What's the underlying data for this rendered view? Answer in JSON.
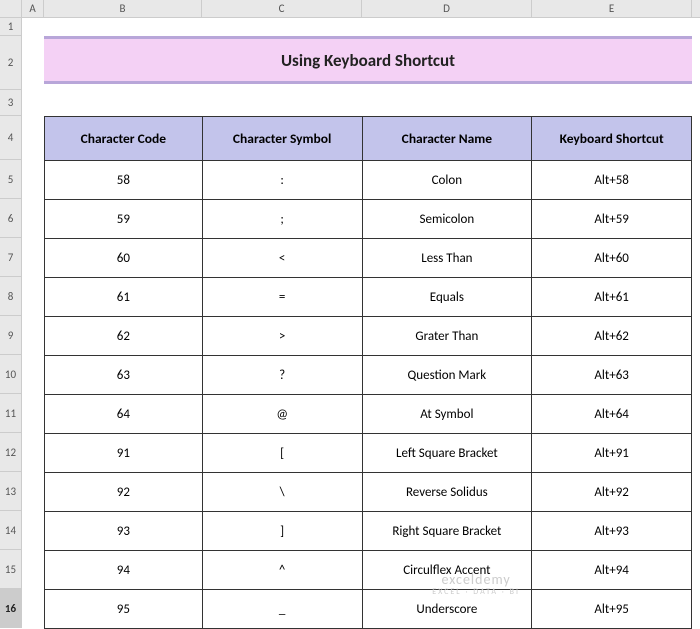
{
  "columns": [
    "A",
    "B",
    "C",
    "D",
    "E"
  ],
  "rows": [
    "1",
    "2",
    "3",
    "4",
    "5",
    "6",
    "7",
    "8",
    "9",
    "10",
    "11",
    "12",
    "13",
    "14",
    "15",
    "16"
  ],
  "selectedRow": "16",
  "title": "Using Keyboard Shortcut",
  "headers": {
    "code": "Character Code",
    "symbol": "Character Symbol",
    "name": "Character Name",
    "shortcut": "Keyboard Shortcut"
  },
  "data": [
    {
      "code": "58",
      "symbol": ":",
      "name": "Colon",
      "shortcut": "Alt+58"
    },
    {
      "code": "59",
      "symbol": ";",
      "name": "Semicolon",
      "shortcut": "Alt+59"
    },
    {
      "code": "60",
      "symbol": "<",
      "name": "Less Than",
      "shortcut": "Alt+60"
    },
    {
      "code": "61",
      "symbol": "=",
      "name": "Equals",
      "shortcut": "Alt+61"
    },
    {
      "code": "62",
      "symbol": ">",
      "name": "Grater Than",
      "shortcut": "Alt+62"
    },
    {
      "code": "63",
      "symbol": "?",
      "name": "Question Mark",
      "shortcut": "Alt+63"
    },
    {
      "code": "64",
      "symbol": "@",
      "name": "At Symbol",
      "shortcut": "Alt+64"
    },
    {
      "code": "91",
      "symbol": "[",
      "name": "Left Square Bracket",
      "shortcut": "Alt+91"
    },
    {
      "code": "92",
      "symbol": "\\",
      "name": "Reverse Solidus",
      "shortcut": "Alt+92"
    },
    {
      "code": "93",
      "symbol": "]",
      "name": "Right Square Bracket",
      "shortcut": "Alt+93"
    },
    {
      "code": "94",
      "symbol": "^",
      "name": "Circulflex Accent",
      "shortcut": "Alt+94"
    },
    {
      "code": "95",
      "symbol": "_",
      "name": "Underscore",
      "shortcut": "Alt+95"
    }
  ],
  "watermark": {
    "brand": "exceldemy",
    "tag": "EXCEL · DATA · BI"
  }
}
